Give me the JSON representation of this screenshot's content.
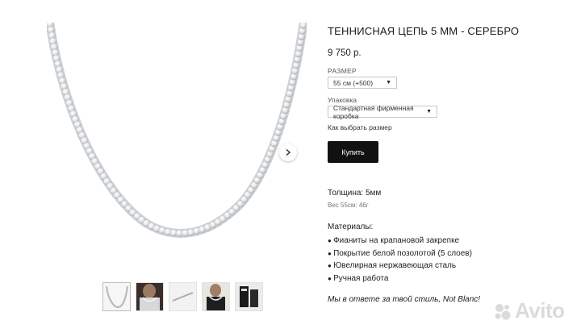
{
  "product": {
    "title": "ТЕННИСНАЯ ЦЕПЬ 5 ММ - СЕРЕБРО",
    "price": "9 750 р.",
    "size_label": "РАЗМЕР",
    "size_value": "55 см (+500)",
    "packaging_label": "Упаковка",
    "packaging_value": "Стандартная фирменная коробка",
    "size_guide_link": "Как выбрать размер",
    "buy_label": "Купить",
    "thickness": "Толщина: 5мм",
    "weight": "Вес 55см: 46г",
    "materials_title": "Материалы:",
    "materials": [
      "Фианиты на крапановой закрепке",
      "Покрытие белой позолотой (5 слоев)",
      "Ювелирная нержавеющая сталь",
      "Ручная работа"
    ],
    "slogan": "Мы в ответе за твой стиль, Not Blanc!"
  },
  "gallery": {
    "next_icon": "chevron-right-icon",
    "thumbnails": [
      "chain-thumbnail",
      "worn-chain-thumbnail",
      "chain-detail-thumbnail",
      "worn-chain-thumbnail-2",
      "packaging-thumbnail"
    ]
  },
  "watermark": {
    "text": "Avito"
  },
  "colors": {
    "button": "#111111",
    "text": "#222222",
    "border": "#c8c8c8"
  }
}
